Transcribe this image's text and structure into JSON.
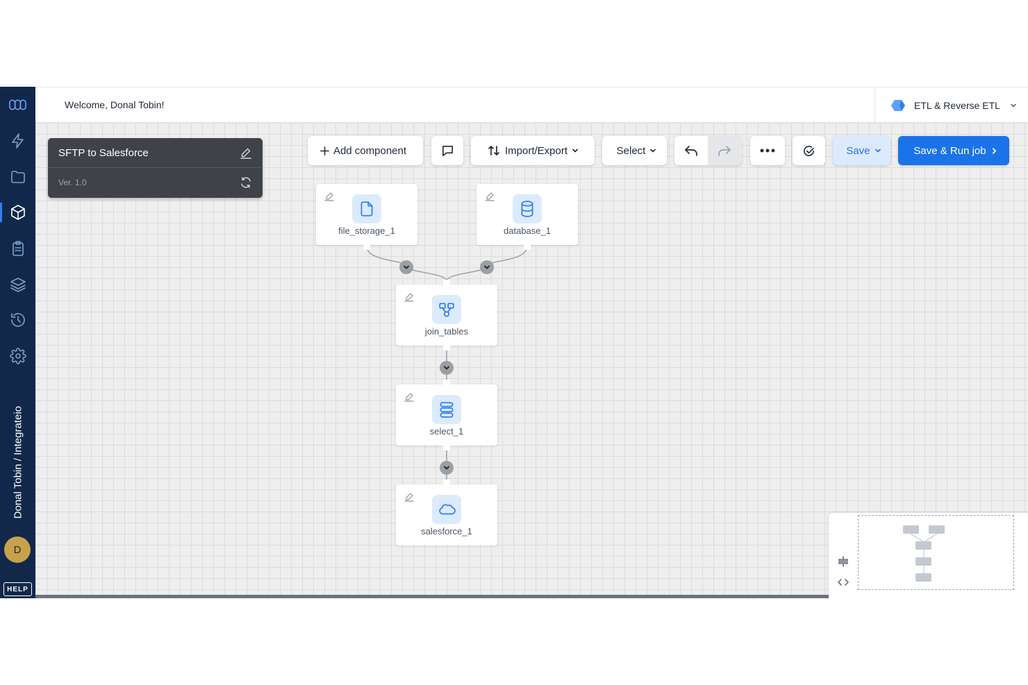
{
  "header": {
    "welcome": "Welcome, Donal Tobin!",
    "product_name": "ETL & Reverse ETL"
  },
  "sidebar": {
    "items": [
      {
        "name": "logo-icon"
      },
      {
        "name": "lightning-icon"
      },
      {
        "name": "folder-icon"
      },
      {
        "name": "package-icon",
        "active": true
      },
      {
        "name": "clipboard-icon"
      },
      {
        "name": "layers-icon"
      },
      {
        "name": "history-icon"
      },
      {
        "name": "gear-icon"
      }
    ],
    "account_path": "Donal Tobin / Integrateio",
    "avatar_initial": "D",
    "help_label": "HELP"
  },
  "pipeline": {
    "name": "SFTP to Salesforce",
    "version": "Ver. 1.0"
  },
  "toolbar": {
    "add_component": "Add component",
    "import_export": "Import/Export",
    "select": "Select",
    "save": "Save",
    "save_run": "Save & Run job"
  },
  "nodes": [
    {
      "id": "file_storage_1",
      "label": "file_storage_1",
      "icon": "file-icon"
    },
    {
      "id": "database_1",
      "label": "database_1",
      "icon": "database-icon"
    },
    {
      "id": "join_tables",
      "label": "join_tables",
      "icon": "join-icon"
    },
    {
      "id": "select_1",
      "label": "select_1",
      "icon": "select-icon"
    },
    {
      "id": "salesforce_1",
      "label": "salesforce_1",
      "icon": "cloud-icon"
    }
  ],
  "colors": {
    "sidebar_bg": "#12284a",
    "primary": "#1a73e8",
    "node_icon_bg": "#dcebfb",
    "pipeline_card_bg": "#3f4349"
  }
}
